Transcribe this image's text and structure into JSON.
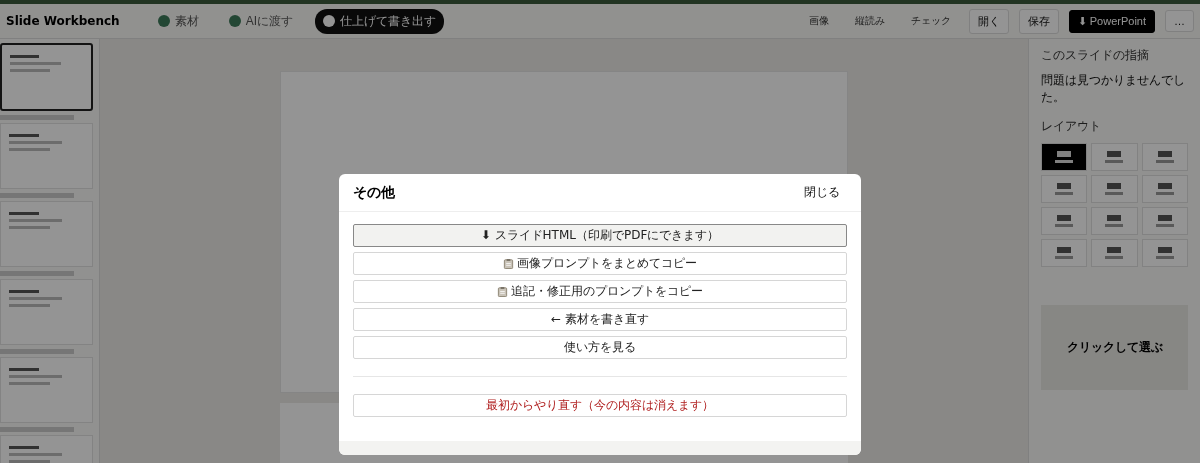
{
  "app": {
    "title": "Slide Workbench",
    "steps": [
      {
        "label": "素材",
        "selected": false
      },
      {
        "label": "AIに渡す",
        "selected": false
      },
      {
        "label": "仕上げて書き出す",
        "selected": true
      }
    ],
    "header_actions": [
      "画像",
      "縦読み",
      "チェック"
    ],
    "header_buttons": [
      {
        "label": "開く",
        "kind": "plain"
      },
      {
        "label": "保存",
        "kind": "plain"
      },
      {
        "label": "⬇ PowerPoint",
        "kind": "primary"
      },
      {
        "label": "…",
        "kind": "plain"
      }
    ]
  },
  "thumbnails": [
    {
      "selected": true
    },
    {
      "selected": false
    },
    {
      "selected": false
    },
    {
      "selected": false
    },
    {
      "selected": false
    },
    {
      "selected": false
    }
  ],
  "right_panel": {
    "issues_heading": "このスライドの指摘",
    "issues_text": "問題は見つかりませんでした。",
    "layout_heading": "レイアウト",
    "layouts": [
      {
        "selected": true
      },
      {
        "selected": false
      },
      {
        "selected": false
      },
      {
        "selected": false
      },
      {
        "selected": false
      },
      {
        "selected": false
      },
      {
        "selected": false
      },
      {
        "selected": false
      },
      {
        "selected": false
      },
      {
        "selected": false
      },
      {
        "selected": false
      },
      {
        "selected": false
      }
    ],
    "drop_title": "クリックして選ぶ"
  },
  "dialog": {
    "title": "その他",
    "close": "閉じる",
    "actions": [
      {
        "label": "⬇ スライドHTML（印刷でPDFにできます）",
        "kind": "primary"
      },
      {
        "label": "画像プロンプトをまとめてコピー",
        "kind": "copy"
      },
      {
        "label": "追記・修正用のプロンプトをコピー",
        "kind": "copy"
      },
      {
        "label": "← 素材を書き直す",
        "kind": "plain"
      },
      {
        "label": "使い方を見る",
        "kind": "plain"
      }
    ],
    "danger": {
      "label": "最初からやり直す（今の内容は消えます）",
      "kind": "danger"
    }
  }
}
